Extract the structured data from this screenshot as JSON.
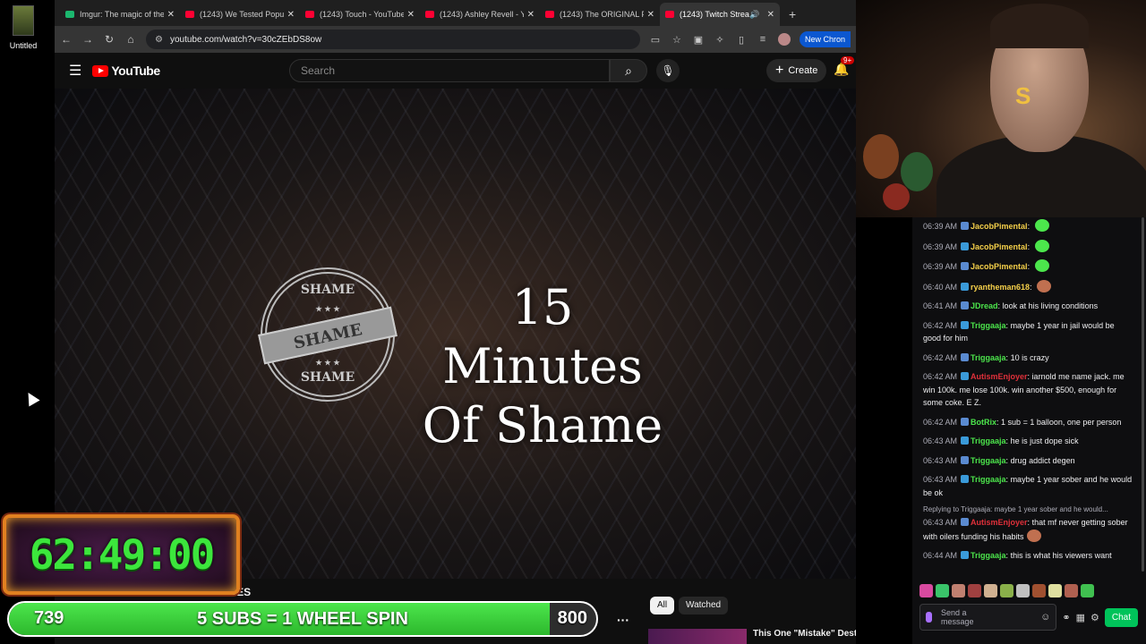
{
  "desktop": {
    "icon_label": "Untitled"
  },
  "browser": {
    "tabs": [
      {
        "title": "Imgur: The magic of the",
        "icon": "imgur-icon"
      },
      {
        "title": "(1243) We Tested Popula",
        "icon": "youtube-icon"
      },
      {
        "title": "(1243) Touch - YouTube",
        "icon": "youtube-icon"
      },
      {
        "title": "(1243) Ashley Revell - Yo",
        "icon": "youtube-icon"
      },
      {
        "title": "(1243) The ORIGINAL Fa",
        "icon": "youtube-icon"
      },
      {
        "title": "(1243) Twitch Stream",
        "icon": "youtube-icon",
        "active": true
      }
    ],
    "url": "youtube.com/watch?v=30cZEbDS8ow",
    "new_chrome": "New Chron"
  },
  "youtube": {
    "logo_text": "YouTube",
    "search_placeholder": "Search",
    "create_label": "Create",
    "notif_badge": "9+",
    "video_title_line1": "15 Minutes",
    "video_title_line2": "Of Shame",
    "stamp_text": "SHAME",
    "video_name": "ARRESTED on FELONY CHARGES",
    "chips": [
      "All",
      "Watched"
    ],
    "rec_title": "This One \"Mistake\" Destroyed a"
  },
  "overlay": {
    "timer": "62:49:00",
    "goal_current": "739",
    "goal_label": "5 SUBS = 1 WHEEL SPIN",
    "goal_target": "800",
    "goal_progress": 0.92,
    "goal_color": "#3ddc3d",
    "timer_color": "#3ce63c"
  },
  "webcam": {
    "sign": "S"
  },
  "chat": {
    "messages": [
      {
        "time": "06:39 AM",
        "user": "JacobPimental",
        "color": "#f5d04a",
        "text": "",
        "emote": true
      },
      {
        "time": "06:39 AM",
        "user": "JacobPimental",
        "color": "#f5d04a",
        "text": "",
        "emote": true
      },
      {
        "time": "06:39 AM",
        "user": "JacobPimental",
        "color": "#f5d04a",
        "text": "",
        "emote": true
      },
      {
        "time": "06:40 AM",
        "user": "ryantheman618",
        "color": "#f5d04a",
        "text": "",
        "emote": true
      },
      {
        "time": "06:41 AM",
        "user": "JDread",
        "color": "#4ce64c",
        "text": "look at his living conditions"
      },
      {
        "time": "06:42 AM",
        "user": "Triggaaja",
        "color": "#4ce64c",
        "text": "maybe 1 year in jail would be good for him"
      },
      {
        "time": "06:42 AM",
        "user": "Triggaaja",
        "color": "#4ce64c",
        "text": "10 is crazy"
      },
      {
        "time": "06:42 AM",
        "user": "AutismEnjoyer",
        "color": "#e0303a",
        "text": "iarnold me name jack. me win 100k. me lose 100k. win another $500, enough for some coke. E Z."
      },
      {
        "time": "06:42 AM",
        "user": "BotRix",
        "color": "#4ce64c",
        "text": "1 sub = 1 balloon, one per person"
      },
      {
        "time": "06:43 AM",
        "user": "Triggaaja",
        "color": "#4ce64c",
        "text": "he is just dope sick"
      },
      {
        "time": "06:43 AM",
        "user": "Triggaaja",
        "color": "#4ce64c",
        "text": "drug addict degen"
      },
      {
        "time": "06:43 AM",
        "user": "Triggaaja",
        "color": "#4ce64c",
        "text": "maybe 1 year sober and he would be ok"
      },
      {
        "time": "06:43 AM",
        "user": "AutismEnjoyer",
        "color": "#e0303a",
        "text": "that mf never getting sober with oilers funding his habits",
        "reply": "Replying to Triggaaja: maybe 1 year sober and he would...",
        "emote": true
      },
      {
        "time": "06:44 AM",
        "user": "Triggaaja",
        "color": "#4ce64c",
        "text": "this is what his viewers want"
      }
    ],
    "input_placeholder": "Send a message",
    "chat_button": "Chat"
  }
}
